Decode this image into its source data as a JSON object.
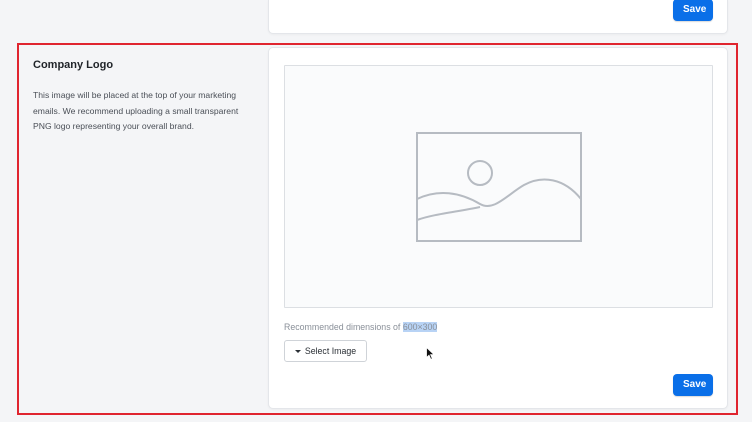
{
  "previous_section": {
    "save_label": "Save"
  },
  "company_logo": {
    "title": "Company Logo",
    "description": "This image will be placed at the top of your marketing emails. We recommend uploading a small transparent PNG logo representing your overall brand.",
    "preview_icon": "image-placeholder-icon",
    "hint_prefix": "Recommended dimensions of ",
    "hint_dimensions": "600×300",
    "select_image_label": "Select Image",
    "select_image_icon": "caret-down-icon",
    "save_label": "Save"
  },
  "colors": {
    "primary": "#0a6fe8",
    "highlight": "#e0252f",
    "selection": "#b8d3f5"
  }
}
